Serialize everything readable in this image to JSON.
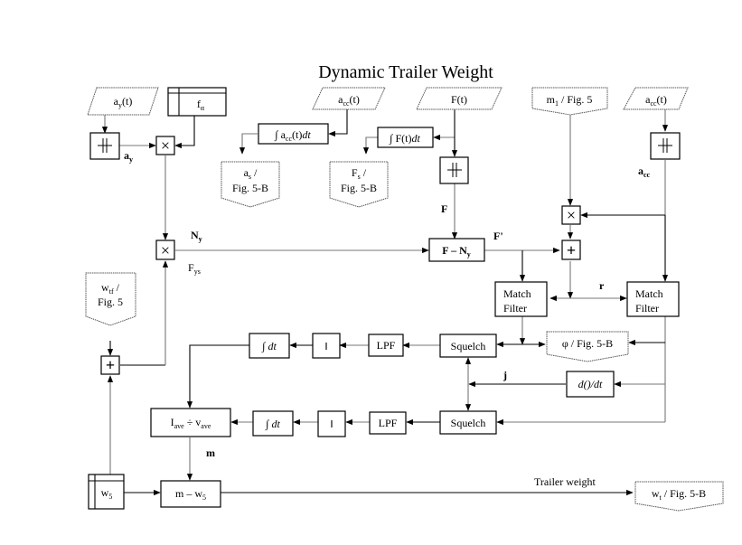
{
  "title": "Dynamic Trailer Weight",
  "inputs": {
    "ay_t": {
      "main": "a",
      "sub": "y",
      "rest": "(t)"
    },
    "acc_t_mid": {
      "main": "a",
      "sub": "cc",
      "rest": "(t)"
    },
    "F_t": "F(t)",
    "acc_t_right": {
      "main": "a",
      "sub": "cc",
      "rest": "(t)"
    }
  },
  "tables": {
    "f_alpha": {
      "main": "f",
      "sub": "α"
    },
    "w5": {
      "main": "w",
      "sub": "5"
    }
  },
  "offpage": {
    "as_fig": {
      "main": "a",
      "sub": "s",
      "rest": " /",
      "line2": "Fig. 5-B"
    },
    "Fs_fig": {
      "main": "F",
      "sub": "s",
      "rest": " /",
      "line2": "Fig. 5-B"
    },
    "m1_fig": {
      "main": "m",
      "sub": "1",
      "rest": " / Fig. 5"
    },
    "wtf_fig": {
      "main": "w",
      "sub": "tf",
      "rest": " /",
      "line2": "Fig. 5"
    },
    "phi_fig": "φ / Fig. 5-B",
    "wt_fig": {
      "main": "w",
      "sub": "t",
      "rest": " / Fig. 5-B"
    }
  },
  "blocks": {
    "integral_acc": {
      "pre": "∫ a",
      "sub": "cc",
      "mid": "(t)",
      "post": "dt"
    },
    "integral_F": {
      "pre": "∫ F(t)",
      "post": "dt"
    },
    "F_minus_Ny": {
      "pre": "F – N",
      "sub": "y"
    },
    "match_filter_1": [
      "Match",
      "Filter"
    ],
    "match_filter_2": [
      "Match",
      "Filter"
    ],
    "squelch_1": "Squelch",
    "squelch_2": "Squelch",
    "lpf_1": "LPF",
    "lpf_2": "LPF",
    "abs_symbol": "‖",
    "integral_dt": {
      "pre": "∫",
      "post": "dt"
    },
    "derivative": "d()/dt",
    "iave_div_vave": {
      "a": "I",
      "asub": "ave",
      "op": " ÷ ",
      "b": "v",
      "bsub": "ave"
    },
    "m_minus_w5": {
      "pre": "m – w",
      "sub": "5"
    }
  },
  "operators": {
    "multiply": "×",
    "add": "+",
    "filter_symbol": "╫"
  },
  "signals": {
    "ay": {
      "main": "a",
      "sub": "y"
    },
    "acc": {
      "main": "a",
      "sub": "cc"
    },
    "F": "F",
    "F_prime": "F'",
    "Ny": {
      "main": "N",
      "sub": "y"
    },
    "Fys": {
      "main": "F",
      "sub": "ys"
    },
    "r": "r",
    "j": "j",
    "m": "m",
    "trailer_weight": "Trailer weight"
  }
}
